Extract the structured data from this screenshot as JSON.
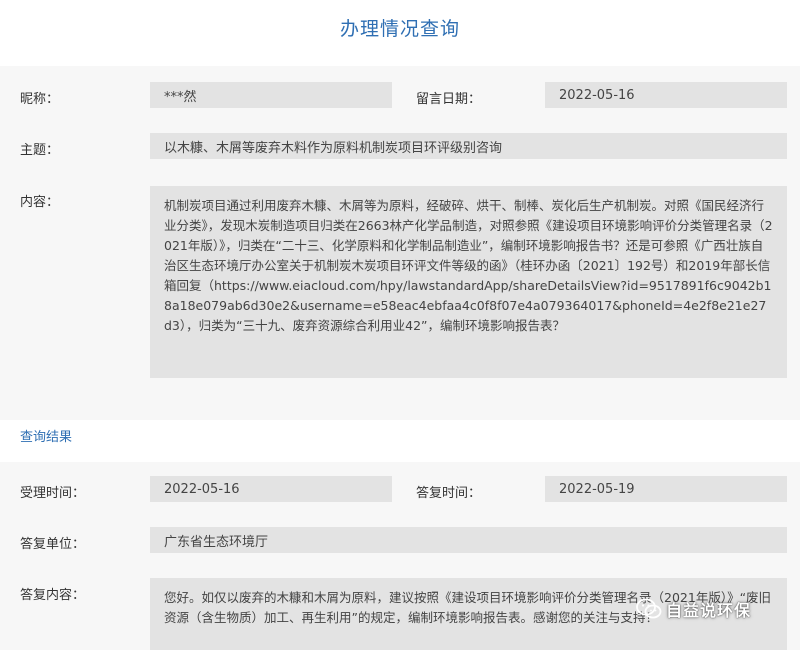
{
  "page": {
    "title": "办理情况查询"
  },
  "inquiry": {
    "nickname_label": "昵称：",
    "nickname_value": "***然",
    "date_label": "留言日期：",
    "date_value": "2022-05-16",
    "subject_label": "主题：",
    "subject_value": "以木糠、木屑等废弃木料作为原料机制炭项目环评级别咨询",
    "content_label": "内容：",
    "content_value": "机制炭项目通过利用废弃木糠、木屑等为原料，经破碎、烘干、制棒、炭化后生产机制炭。对照《国民经济行业分类》，发现木炭制造项目归类在2663林产化学品制造，对照参照《建设项目环境影响评价分类管理名录（2021年版）》，归类在“二十三、化学原料和化学制品制造业”，编制环境影响报告书？还是可参照《广西壮族自治区生态环境厅办公室关于机制炭木炭项目环评文件等级的函》（桂环办函〔2021〕192号）和2019年部长信箱回复（https://www.eiacloud.com/hpy/lawstandardApp/shareDetailsView?id=9517891f6c9042b18a18e079ab6d30e2&username=e58eac4ebfaa4c0f8f07e4a079364017&phoneId=4e2f8e21e27d3），归类为“三十九、废弃资源综合利用业42”，编制环境影响报告表？"
  },
  "result": {
    "section_title": "查询结果",
    "accept_time_label": "受理时间：",
    "accept_time_value": "2022-05-16",
    "reply_time_label": "答复时间：",
    "reply_time_value": "2022-05-19",
    "reply_unit_label": "答复单位：",
    "reply_unit_value": "广东省生态环境厅",
    "reply_content_label": "答复内容：",
    "reply_content_value": "您好。如仅以废弃的木糠和木屑为原料，建议按照《建设项目环境影响评价分类管理名录（2021年版）》“废旧资源（含生物质）加工、再生利用”的规定，编制环境影响报告表。感谢您的关注与支持！"
  },
  "watermark": {
    "text": "自益说环保",
    "icon": "wechat-icon"
  },
  "colors": {
    "accent": "#2f6fb3",
    "field_bg": "#e3e3e3",
    "band_bg": "#f7f7f7"
  }
}
